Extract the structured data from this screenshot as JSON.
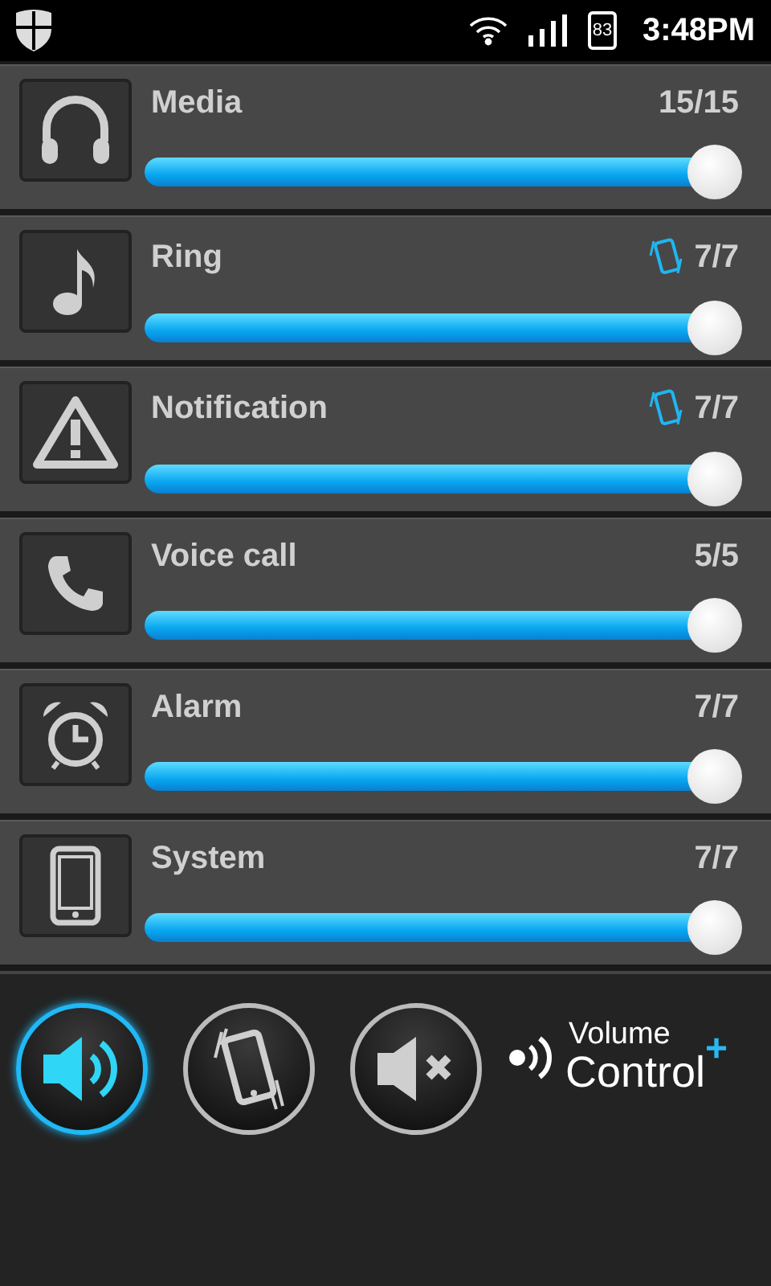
{
  "status_bar": {
    "battery": "83",
    "time": "3:48PM"
  },
  "channels": [
    {
      "kind": "media",
      "name": "Media",
      "reading": "15/15",
      "vibrate": false,
      "level": 1
    },
    {
      "kind": "ring",
      "name": "Ring",
      "reading": "7/7",
      "vibrate": true,
      "level": 1
    },
    {
      "kind": "notification",
      "name": "Notification",
      "reading": "7/7",
      "vibrate": true,
      "level": 1
    },
    {
      "kind": "call",
      "name": "Voice call",
      "reading": "5/5",
      "vibrate": false,
      "level": 1
    },
    {
      "kind": "alarm",
      "name": "Alarm",
      "reading": "7/7",
      "vibrate": false,
      "level": 1
    },
    {
      "kind": "system",
      "name": "System",
      "reading": "7/7",
      "vibrate": false,
      "level": 1
    }
  ],
  "modes": [
    {
      "kind": "sound",
      "selected": true
    },
    {
      "kind": "vibrate",
      "selected": false
    },
    {
      "kind": "mute",
      "selected": false
    }
  ],
  "logo": {
    "line_1": "Volume",
    "line_2": "Control",
    "mark": "+"
  }
}
